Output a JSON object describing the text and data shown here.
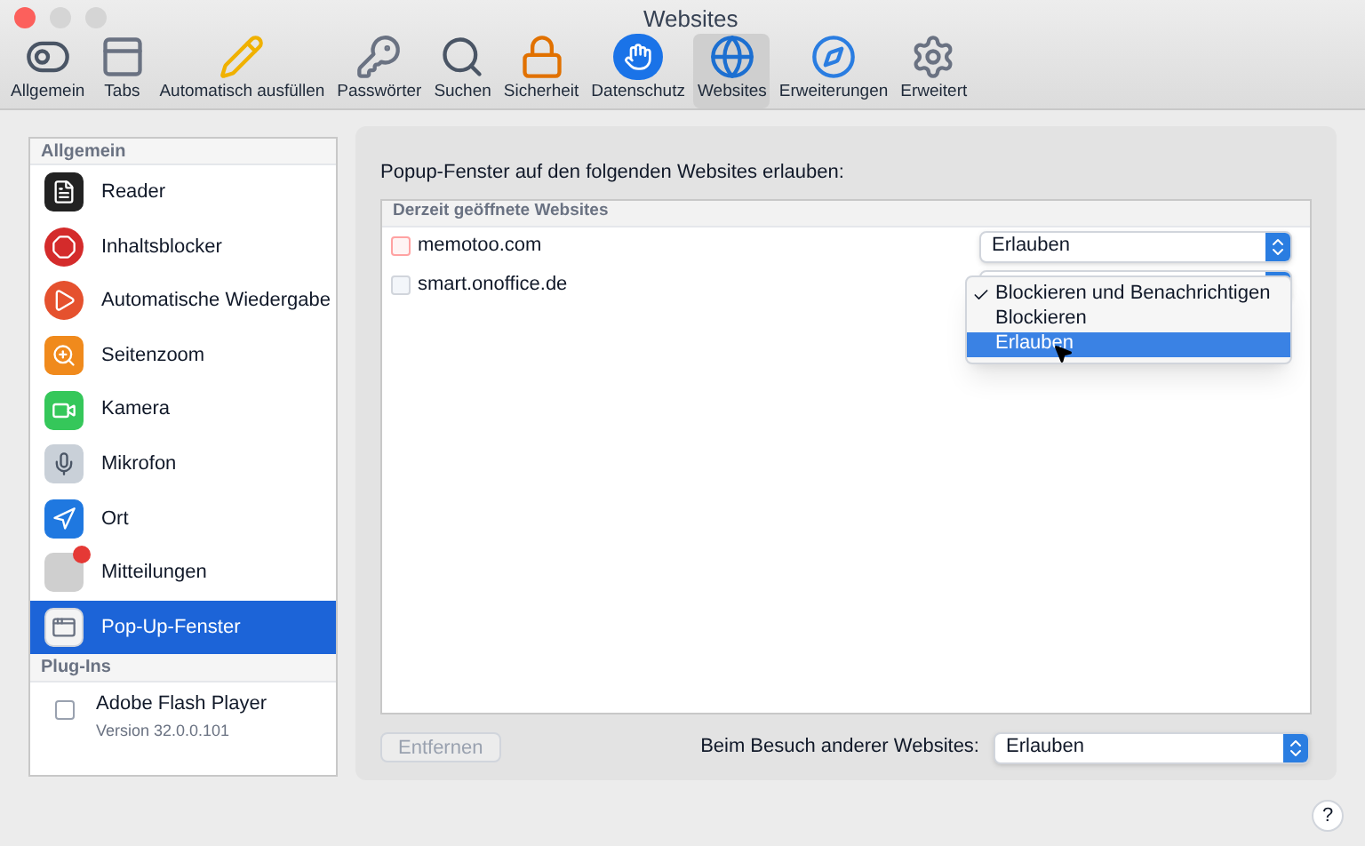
{
  "window": {
    "title": "Websites"
  },
  "toolbar": [
    {
      "kind": "general",
      "label": "Allgemein",
      "selected": false
    },
    {
      "kind": "tabs",
      "label": "Tabs",
      "selected": false
    },
    {
      "kind": "autofill",
      "label": "Automatisch ausfüllen",
      "selected": false
    },
    {
      "kind": "passwords",
      "label": "Passwörter",
      "selected": false
    },
    {
      "kind": "search",
      "label": "Suchen",
      "selected": false
    },
    {
      "kind": "security",
      "label": "Sicherheit",
      "selected": false
    },
    {
      "kind": "privacy",
      "label": "Datenschutz",
      "selected": false
    },
    {
      "kind": "websites",
      "label": "Websites",
      "selected": true
    },
    {
      "kind": "extensions",
      "label": "Erweiterungen",
      "selected": false
    },
    {
      "kind": "advanced",
      "label": "Erweitert",
      "selected": false
    }
  ],
  "sidebar": {
    "section_general": "Allgemein",
    "items": [
      {
        "kind": "reader",
        "label": "Reader",
        "selected": false
      },
      {
        "kind": "blocker",
        "label": "Inhaltsblocker",
        "selected": false
      },
      {
        "kind": "autoplay",
        "label": "Automatische Wiedergabe",
        "selected": false
      },
      {
        "kind": "zoom",
        "label": "Seitenzoom",
        "selected": false
      },
      {
        "kind": "camera",
        "label": "Kamera",
        "selected": false
      },
      {
        "kind": "mic",
        "label": "Mikrofon",
        "selected": false
      },
      {
        "kind": "location",
        "label": "Ort",
        "selected": false
      },
      {
        "kind": "notifications",
        "label": "Mitteilungen",
        "selected": false
      },
      {
        "kind": "popup",
        "label": "Pop-Up-Fenster",
        "selected": true
      }
    ],
    "section_plugins": "Plug-Ins",
    "plugins": [
      {
        "name": "Adobe Flash Player",
        "version": "Version 32.0.0.101",
        "checked": false
      }
    ]
  },
  "panel": {
    "heading": "Popup-Fenster auf den folgenden Websites erlauben:",
    "table_header": "Derzeit geöffnete Websites",
    "sites": [
      {
        "kind": "calendar",
        "name": "memotoo.com",
        "value": "Erlauben"
      },
      {
        "kind": "generic",
        "name": "smart.onoffice.de"
      }
    ],
    "open_menu": [
      {
        "label": "Blockieren und Benachrichtigen",
        "checked": true,
        "highlighted": false
      },
      {
        "label": "Blockieren",
        "checked": false,
        "highlighted": false
      },
      {
        "label": "Erlauben",
        "checked": false,
        "highlighted": true
      }
    ],
    "remove_button": {
      "label": "Entfernen",
      "disabled": true
    },
    "other_label": "Beim Besuch anderer Websites:",
    "other_value": "Erlauben",
    "help": "?"
  }
}
